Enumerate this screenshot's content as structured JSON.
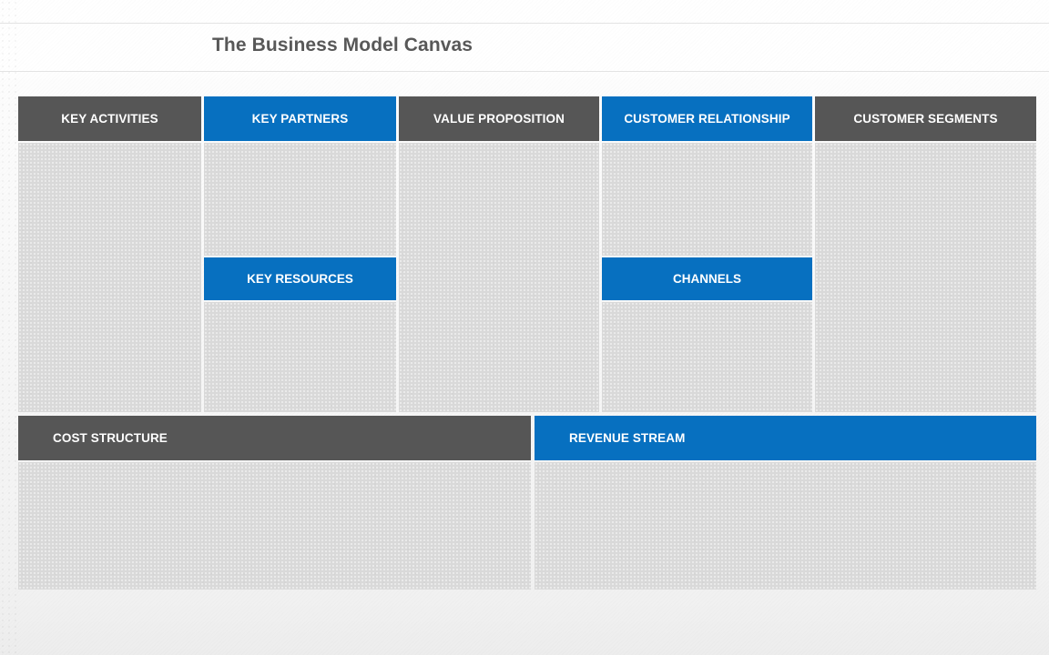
{
  "slide": {
    "title": "The Business Model Canvas",
    "colors": {
      "accent_blue": "#0770c0",
      "header_gray": "#565656",
      "cell_fill": "#d9d9d9",
      "title_text": "#585858",
      "header_text": "#ffffff"
    }
  },
  "canvas": {
    "columns": [
      {
        "id": "key-activities",
        "header": "KEY ACTIVITIES",
        "header_style": "gray",
        "header_align": "center",
        "split": false
      },
      {
        "id": "key-partners",
        "header": "KEY PARTNERS",
        "header_style": "blue",
        "header_align": "center",
        "split": true,
        "subheader": "KEY RESOURCES"
      },
      {
        "id": "value-proposition",
        "header": "VALUE PROPOSITION",
        "header_style": "gray",
        "header_align": "center",
        "split": false
      },
      {
        "id": "customer-relationship",
        "header": "CUSTOMER RELATIONSHIP",
        "header_style": "blue",
        "header_align": "center",
        "split": true,
        "subheader": "CHANNELS"
      },
      {
        "id": "customer-segments",
        "header": "CUSTOMER SEGMENTS",
        "header_style": "gray",
        "header_align": "center",
        "split": false
      }
    ],
    "bottom": [
      {
        "id": "cost-structure",
        "header": "COST STRUCTURE",
        "header_style": "gray",
        "header_align": "left"
      },
      {
        "id": "revenue-stream",
        "header": "REVENUE STREAM",
        "header_style": "blue",
        "header_align": "left"
      }
    ]
  }
}
